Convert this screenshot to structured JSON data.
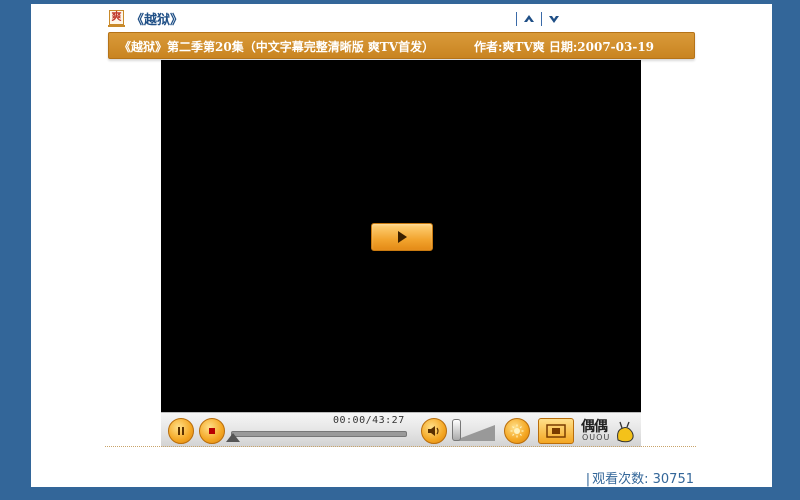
{
  "topbar": {
    "site_icon_glyph": "爽",
    "topic_title": "《越狱》",
    "nav": [
      "up-arrow-icon",
      "down-arrow-icon"
    ]
  },
  "post": {
    "title": "《越狱》第二季第20集（中文字幕完整清晰版 爽TV首发）",
    "meta": "作者:爽TV爽 日期:2007-03-19"
  },
  "player": {
    "time": "00:00/43:27",
    "progress": 0.0,
    "brand": "偶偶",
    "brand_sub": "OUOU",
    "accent": "#f4a622"
  },
  "footer": {
    "separator": "|",
    "view_count": "观看次数: 30751"
  },
  "colors": {
    "background": "#336699",
    "header_band": "#cf8d2b",
    "link": "#1f4f86"
  }
}
